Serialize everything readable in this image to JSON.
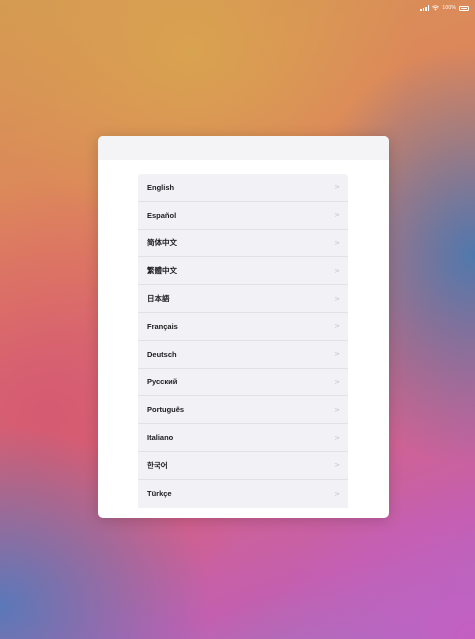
{
  "status_bar": {
    "battery_text": "100%",
    "signal_icon": "cellular-signal-icon",
    "wifi_icon": "wifi-icon",
    "battery_icon": "battery-icon"
  },
  "language_picker": {
    "chevron_glyph": ">",
    "items": [
      {
        "label": "English"
      },
      {
        "label": "Español"
      },
      {
        "label": "简体中文"
      },
      {
        "label": "繁體中文"
      },
      {
        "label": "日本語"
      },
      {
        "label": "Français"
      },
      {
        "label": "Deutsch"
      },
      {
        "label": "Русский"
      },
      {
        "label": "Português"
      },
      {
        "label": "Italiano"
      },
      {
        "label": "한국어"
      },
      {
        "label": "Türkçe"
      }
    ]
  }
}
